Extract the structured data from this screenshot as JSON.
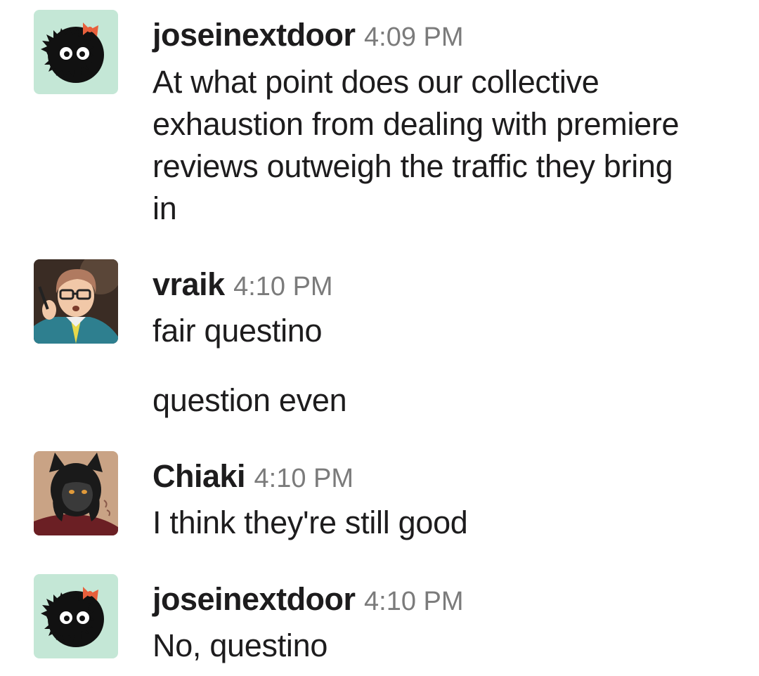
{
  "messages": [
    {
      "author": "joseinextdoor",
      "time": "4:09 PM",
      "avatar_icon": "soot-sprite-with-bow-icon",
      "lines": [
        "At what point does our collective exhaustion from dealing with premiere reviews outweigh the traffic they bring in"
      ]
    },
    {
      "author": "vraik",
      "time": "4:10 PM",
      "avatar_icon": "person-with-glasses-icon",
      "lines": [
        "fair questino",
        "question even"
      ]
    },
    {
      "author": "Chiaki",
      "time": "4:10 PM",
      "avatar_icon": "dark-catgirl-icon",
      "lines": [
        "I think they're still good"
      ]
    },
    {
      "author": "joseinextdoor",
      "time": "4:10 PM",
      "avatar_icon": "soot-sprite-with-bow-icon",
      "lines": [
        "No, questino"
      ]
    }
  ],
  "colors": {
    "soot_avatar_bg": "#c4e7d6",
    "bow": "#e8603c",
    "timestamp": "#7b7b7b",
    "text": "#1d1c1d"
  }
}
